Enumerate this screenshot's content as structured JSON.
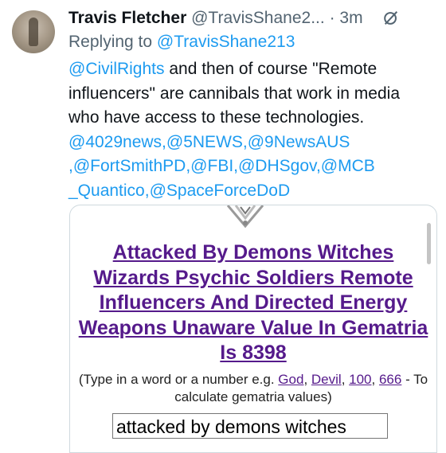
{
  "tweet": {
    "author_name": "Travis Fletcher",
    "author_handle": "@TravisShane2...",
    "separator": "·",
    "time": "3m",
    "replying_prefix": "Replying to",
    "replying_to": "@TravisShane213",
    "body": {
      "mention_civil": "@CivilRights",
      "text": " and then of course \"Remote influencers\" are cannibals that work in media who have access to these technologies.",
      "mentions_line1": "@4029news,@5NEWS,@9NewsAUS",
      "mentions_line2": ",@FortSmithPD,@FBI,@DHSgov,@MCB",
      "mentions_line3": "_Quantico,@SpaceForceDoD"
    }
  },
  "card": {
    "title": "Attacked By Demons Witches Wizards Psychic Soldiers Remote Influencers And Directed Energy Weapons Unaware Value In Gematria Is 8398",
    "help_prefix": "(Type in a word or a number e.g. ",
    "help_link_god": "God",
    "help_comma1": ", ",
    "help_link_devil": "Devil",
    "help_comma2": ", ",
    "help_link_100": "100",
    "help_comma3": ", ",
    "help_link_666": "666",
    "help_suffix": " - To calculate gematria values)",
    "input_value": "attacked by demons witches"
  },
  "colors": {
    "link": "#1d9bf0",
    "secondary_text": "#536471",
    "card_link": "#551a8b"
  },
  "icons": {
    "mute": "mute-icon",
    "emblem": "emblem-icon"
  }
}
